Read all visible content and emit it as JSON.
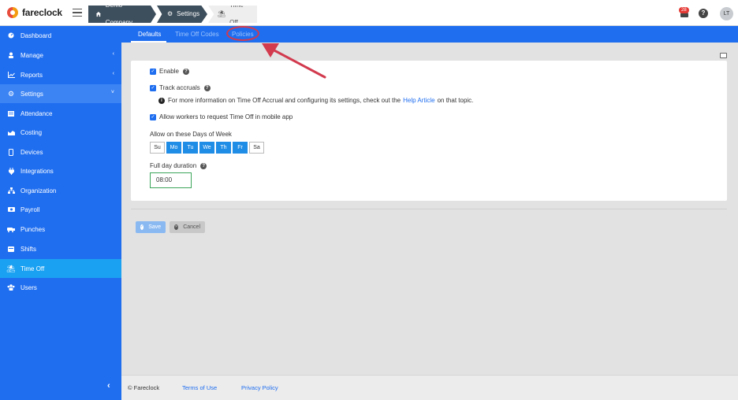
{
  "app": {
    "logo_text": "fareclock"
  },
  "breadcrumb": {
    "items": [
      "Demo Company",
      "Settings",
      "Time Off"
    ]
  },
  "header": {
    "notification_count": "28",
    "help_label": "?",
    "avatar_initials": "LT"
  },
  "sidebar": {
    "items": [
      {
        "label": "Dashboard",
        "icon": "dashboard-icon"
      },
      {
        "label": "Manage",
        "icon": "user-icon",
        "chevron": "‹"
      },
      {
        "label": "Reports",
        "icon": "chart-icon",
        "chevron": "‹"
      },
      {
        "label": "Settings",
        "icon": "gear-icon",
        "chevron": "˅"
      },
      {
        "label": "Attendance",
        "icon": "attendance-icon"
      },
      {
        "label": "Costing",
        "icon": "costing-icon"
      },
      {
        "label": "Devices",
        "icon": "device-icon"
      },
      {
        "label": "Integrations",
        "icon": "plug-icon"
      },
      {
        "label": "Organization",
        "icon": "org-icon"
      },
      {
        "label": "Payroll",
        "icon": "payroll-icon"
      },
      {
        "label": "Punches",
        "icon": "punch-icon"
      },
      {
        "label": "Shifts",
        "icon": "calendar-icon"
      },
      {
        "label": "Time Off",
        "icon": "umbrella-icon"
      },
      {
        "label": "Users",
        "icon": "users-icon"
      }
    ],
    "collapse_label": "‹"
  },
  "tabs": [
    "Defaults",
    "Time Off Codes",
    "Policies"
  ],
  "form": {
    "enable_label": "Enable",
    "track_accruals_label": "Track accruals",
    "info_text_before": "For more information on Time Off Accrual and configuring its settings, check out the",
    "info_link": "Help Article",
    "info_text_after": "on that topic.",
    "mobile_label": "Allow workers to request Time Off in mobile app",
    "days_label": "Allow on these Days of Week",
    "days": [
      {
        "label": "Su",
        "on": false
      },
      {
        "label": "Mo",
        "on": true
      },
      {
        "label": "Tu",
        "on": true
      },
      {
        "label": "We",
        "on": true
      },
      {
        "label": "Th",
        "on": true
      },
      {
        "label": "Fr",
        "on": true
      },
      {
        "label": "Sa",
        "on": false
      }
    ],
    "duration_label": "Full day duration",
    "duration_value": "08:00",
    "save_label": "Save",
    "cancel_label": "Cancel"
  },
  "footer": {
    "copyright": "© Fareclock",
    "terms": "Terms of Use",
    "privacy": "Privacy Policy"
  },
  "colors": {
    "sidebar": "#1f6ef0",
    "active_item": "#1aa1f2",
    "annotation": "#d23a4e"
  }
}
